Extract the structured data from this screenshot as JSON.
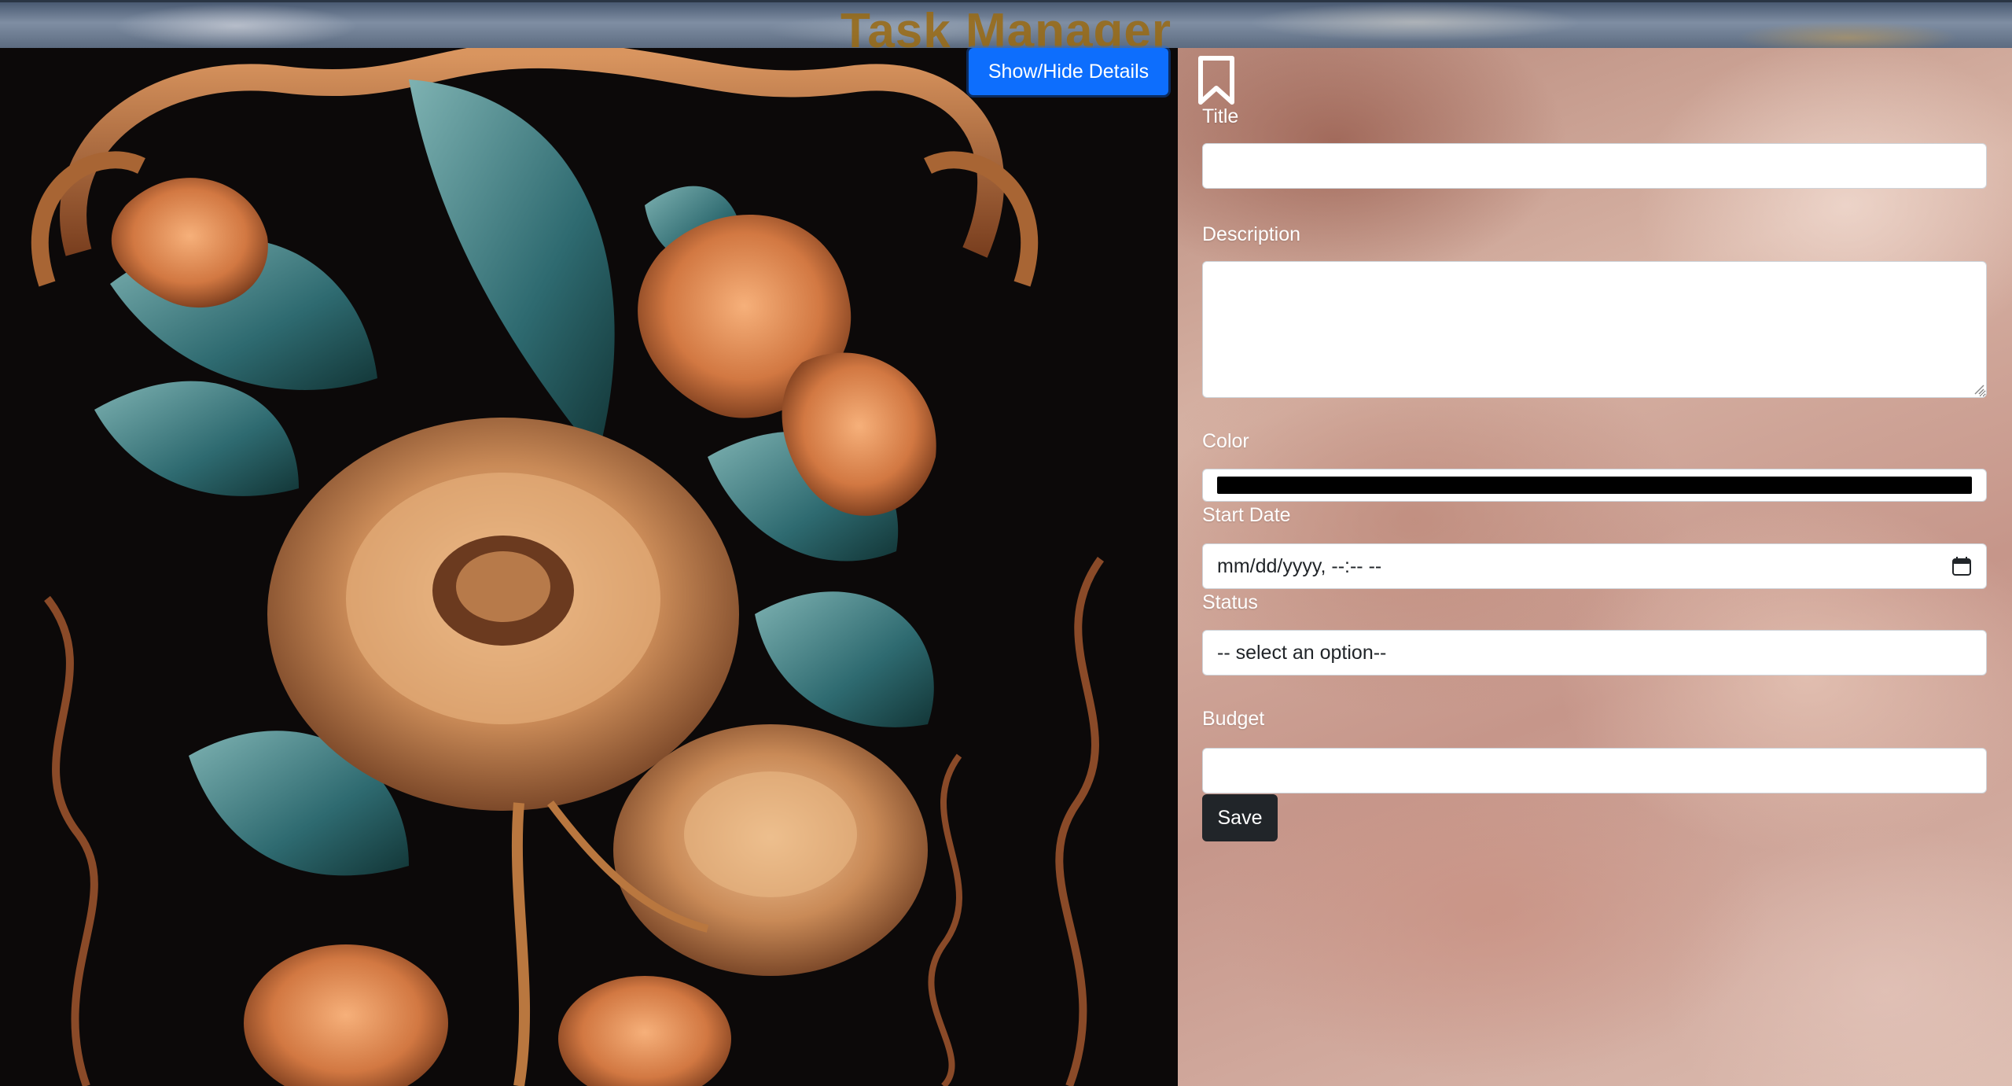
{
  "header": {
    "title": "Task Manager"
  },
  "toolbar": {
    "toggle_details_label": "Show/Hide Details"
  },
  "icons": {
    "bookmark": "bookmark-icon",
    "calendar": "calendar-icon"
  },
  "form": {
    "title_label": "Title",
    "title_value": "",
    "description_label": "Description",
    "description_value": "",
    "color_label": "Color",
    "color_value": "#000000",
    "start_date_label": "Start Date",
    "start_date_placeholder": "mm/dd/yyyy, --:-- --",
    "status_label": "Status",
    "status_selected": "-- select an option--",
    "budget_label": "Budget",
    "budget_value": "",
    "save_label": "Save"
  },
  "colors": {
    "primary_button": "#0d6efd",
    "dark_button": "#212529",
    "title_color": "#9a6a12"
  }
}
